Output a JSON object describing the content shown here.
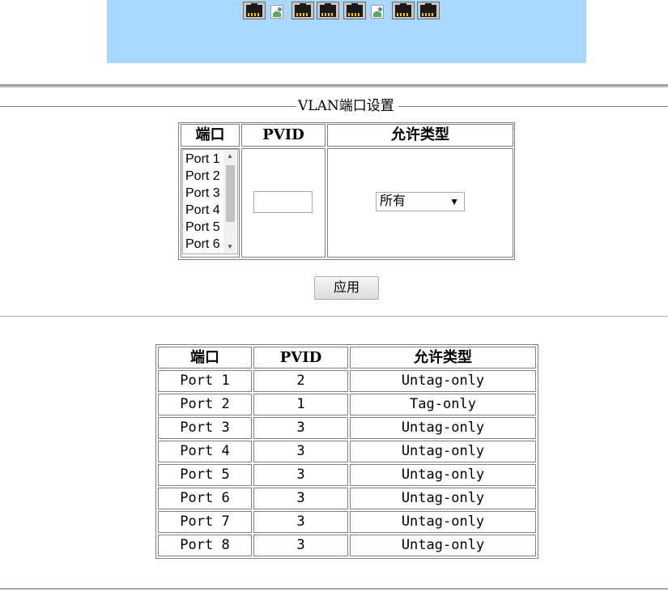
{
  "port_panel": {
    "background": "#aad8fc",
    "icons": [
      {
        "icon": "ethernet-port-linked-icon",
        "state": "linked"
      },
      {
        "icon": "broken-image-icon",
        "state": "broken"
      },
      {
        "icon": "ethernet-port-linked-icon",
        "state": "linked"
      },
      {
        "icon": "ethernet-port-linked-icon",
        "state": "linked"
      },
      {
        "icon": "ethernet-port-linked-icon",
        "state": "linked"
      },
      {
        "icon": "broken-image-icon",
        "state": "broken"
      },
      {
        "icon": "ethernet-port-linked-icon",
        "state": "linked"
      },
      {
        "icon": "ethernet-port-linked-icon",
        "state": "linked"
      }
    ]
  },
  "vlan_config": {
    "legend": "VLAN端口设置",
    "headers": {
      "port": "端口",
      "pvid": "PVID",
      "type": "允许类型"
    },
    "port_options": [
      "Port 1",
      "Port 2",
      "Port 3",
      "Port 4",
      "Port 5",
      "Port 6"
    ],
    "pvid_value": "",
    "type_selected": "所有",
    "apply_label": "应用"
  },
  "status_table": {
    "headers": {
      "port": "端口",
      "pvid": "PVID",
      "type": "允许类型"
    },
    "rows": [
      {
        "port": "Port 1",
        "pvid": "2",
        "type": "Untag-only"
      },
      {
        "port": "Port 2",
        "pvid": "1",
        "type": "Tag-only"
      },
      {
        "port": "Port 3",
        "pvid": "3",
        "type": "Untag-only"
      },
      {
        "port": "Port 4",
        "pvid": "3",
        "type": "Untag-only"
      },
      {
        "port": "Port 5",
        "pvid": "3",
        "type": "Untag-only"
      },
      {
        "port": "Port 6",
        "pvid": "3",
        "type": "Untag-only"
      },
      {
        "port": "Port 7",
        "pvid": "3",
        "type": "Untag-only"
      },
      {
        "port": "Port 8",
        "pvid": "3",
        "type": "Untag-only"
      }
    ]
  }
}
